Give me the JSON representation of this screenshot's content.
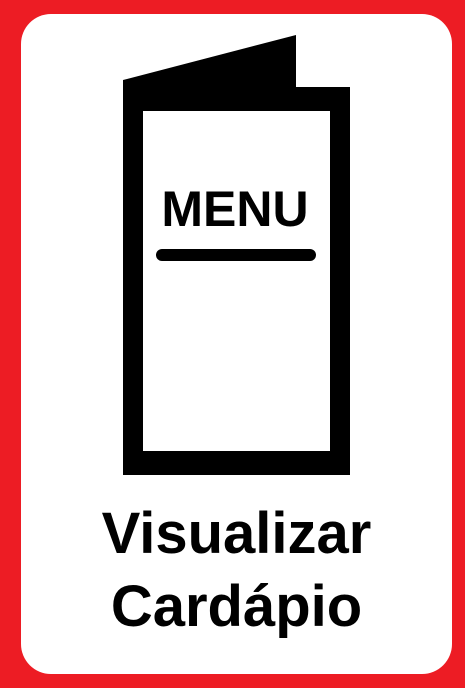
{
  "button": {
    "icon_name": "menu-booklet-icon",
    "icon_text": "MENU",
    "label_line1": "Visualizar",
    "label_line2": "Cardápio"
  },
  "colors": {
    "border": "#ed1c24",
    "background": "#ffffff",
    "foreground": "#000000"
  }
}
